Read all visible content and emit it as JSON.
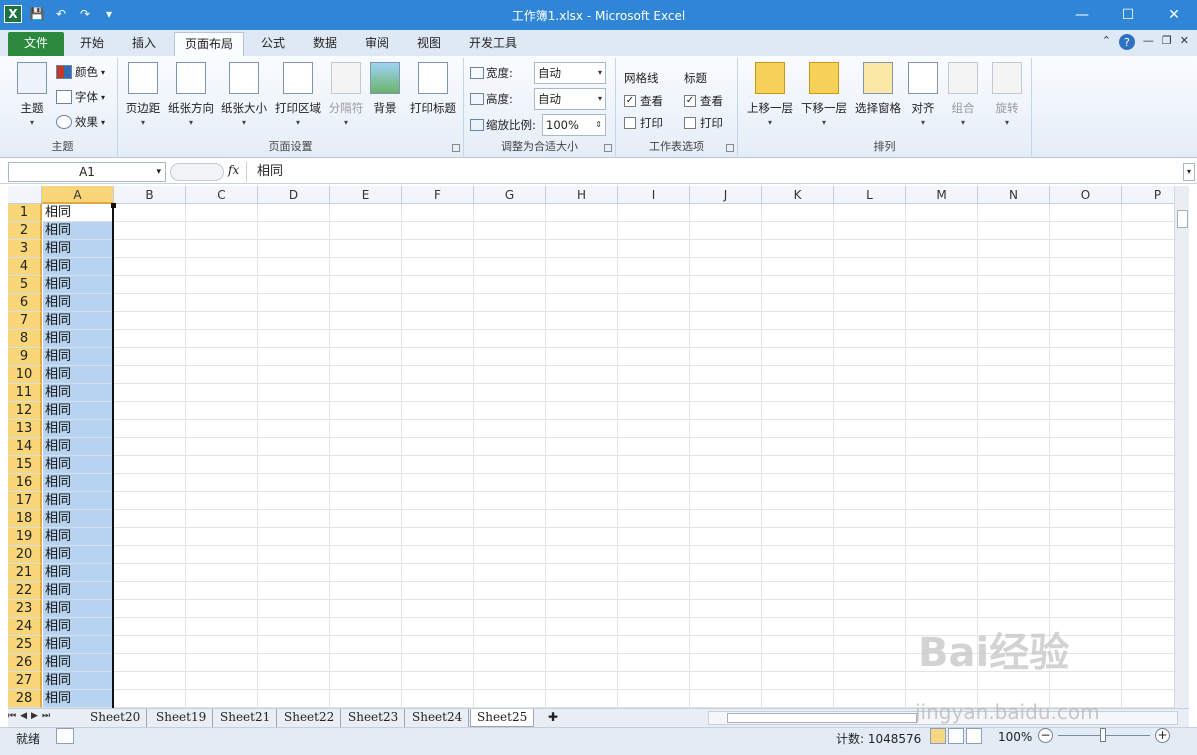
{
  "window": {
    "title": "工作簿1.xlsx  -  Microsoft Excel",
    "controls": [
      "—",
      "☐",
      "✕"
    ]
  },
  "tabs": [
    {
      "label": "文件"
    },
    {
      "label": "开始"
    },
    {
      "label": "插入"
    },
    {
      "label": "页面布局"
    },
    {
      "label": "公式"
    },
    {
      "label": "数据"
    },
    {
      "label": "审阅"
    },
    {
      "label": "视图"
    },
    {
      "label": "开发工具"
    }
  ],
  "ribbon": {
    "theme": {
      "group": "主题",
      "themes": "主题",
      "colors": "颜色",
      "fonts": "字体",
      "effects": "效果"
    },
    "page_setup": {
      "group": "页面设置",
      "margins": "页边距",
      "orientation": "纸张方向",
      "size": "纸张大小",
      "print_area": "打印区域",
      "breaks": "分隔符",
      "background": "背景",
      "print_titles": "打印标题"
    },
    "scale": {
      "group": "调整为合适大小",
      "width_label": "宽度:",
      "width_value": "自动",
      "height_label": "高度:",
      "height_value": "自动",
      "scale_label": "缩放比例:",
      "scale_value": "100%"
    },
    "sheet_options": {
      "group": "工作表选项",
      "gridlines": "网格线",
      "headings": "标题",
      "view": "查看",
      "print": "打印",
      "gridlines_view": true,
      "gridlines_print": false,
      "headings_view": true,
      "headings_print": false
    },
    "arrange": {
      "group": "排列",
      "bring_forward": "上移一层",
      "send_backward": "下移一层",
      "selection_pane": "选择窗格",
      "align": "对齐",
      "group_btn": "组合",
      "rotate": "旋转"
    }
  },
  "formula_bar": {
    "name_box": "A1",
    "fx": "fx",
    "content": "相同"
  },
  "grid": {
    "columns": [
      "A",
      "B",
      "C",
      "D",
      "E",
      "F",
      "G",
      "H",
      "I",
      "J",
      "K",
      "L",
      "M",
      "N",
      "O",
      "P"
    ],
    "rows": [
      "1",
      "2",
      "3",
      "4",
      "5",
      "6",
      "7",
      "8",
      "9",
      "10",
      "11",
      "12",
      "13",
      "14",
      "15",
      "16",
      "17",
      "18",
      "19",
      "20",
      "21",
      "22",
      "23",
      "24",
      "25",
      "26",
      "27",
      "28"
    ],
    "columnA": [
      "相同",
      "相同",
      "相同",
      "相同",
      "相同",
      "相同",
      "相同",
      "相同",
      "相同",
      "相同",
      "相同",
      "相同",
      "相同",
      "相同",
      "相同",
      "相同",
      "相同",
      "相同",
      "相同",
      "相同",
      "相同",
      "相同",
      "相同",
      "相同",
      "相同",
      "相同",
      "相同",
      "相同"
    ]
  },
  "sheets": [
    "Sheet20",
    "Sheet19",
    "Sheet21",
    "Sheet22",
    "Sheet23",
    "Sheet24",
    "Sheet25"
  ],
  "active_sheet": "Sheet25",
  "status": {
    "ready": "就绪",
    "count": "计数: 1048576",
    "zoom": "100%"
  },
  "watermark": {
    "brand": "Bai经验",
    "url": "jingyan.baidu.com"
  },
  "colors": {
    "title_bar": "#2f86d6",
    "file_tab": "#2b8a3e",
    "selection": "#b7d3f0",
    "header_selected": "#f9d778"
  }
}
